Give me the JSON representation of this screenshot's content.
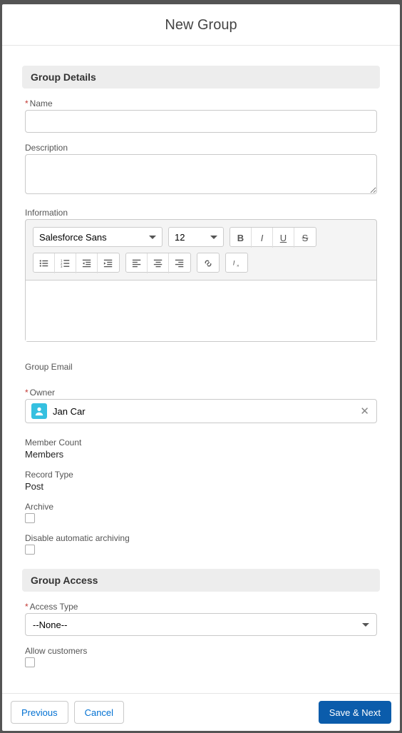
{
  "modal_title": "New Group",
  "sections": {
    "details": "Group Details",
    "access": "Group Access"
  },
  "fields": {
    "name_label": "Name",
    "description_label": "Description",
    "information_label": "Information",
    "group_email_label": "Group Email",
    "owner_label": "Owner",
    "member_count_label": "Member Count",
    "member_count_value": "Members",
    "record_type_label": "Record Type",
    "record_type_value": "Post",
    "archive_label": "Archive",
    "disable_archive_label": "Disable automatic archiving",
    "access_type_label": "Access Type",
    "access_type_value": "--None--",
    "allow_customers_label": "Allow customers"
  },
  "owner": {
    "name": "Jan Car"
  },
  "rte": {
    "font": "Salesforce Sans",
    "size": "12"
  },
  "buttons": {
    "previous": "Previous",
    "cancel": "Cancel",
    "save_next": "Save & Next"
  }
}
